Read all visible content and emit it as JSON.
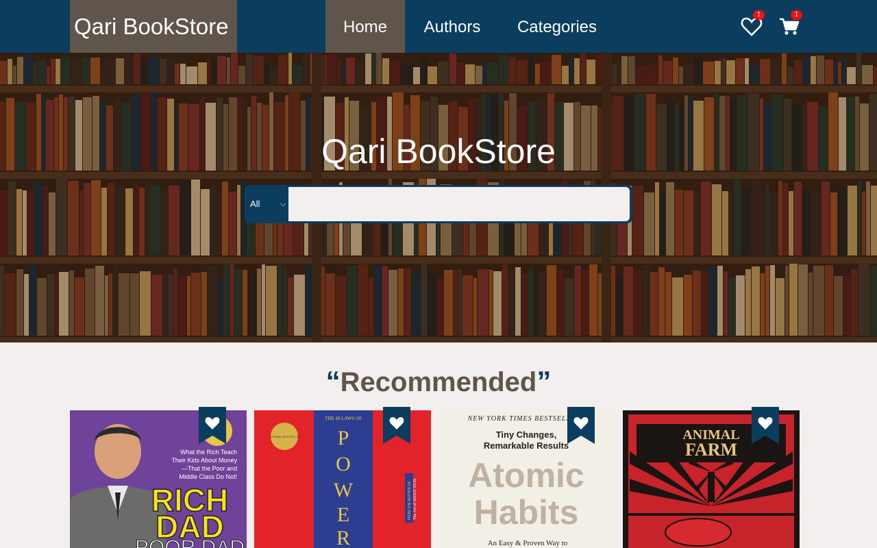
{
  "navbar": {
    "brand": "Qari BookStore",
    "links": [
      {
        "label": "Home",
        "active": true
      },
      {
        "label": "Authors",
        "active": false
      },
      {
        "label": "Categories",
        "active": false
      }
    ],
    "wishlist_count": "1",
    "cart_count": "1",
    "icons": [
      "heart-icon",
      "cart-icon"
    ]
  },
  "hero": {
    "title": "Qari BookStore",
    "search": {
      "category_selected": "All",
      "value": "",
      "placeholder": ""
    }
  },
  "recommended": {
    "open_quote": "“",
    "title": "Recommended",
    "close_quote": "”",
    "books": [
      {
        "cover_texts": [
          "What the Rich Teach",
          "Their Kids About Money",
          "—That the Poor and",
          "Middle Class Do Not!",
          "RICH",
          "DAD",
          "POOR DAD"
        ]
      },
      {
        "cover_texts": [
          "THE 48 LAWS OF",
          "NATIONAL BESTSELLER",
          "P",
          "O",
          "W",
          "E",
          "R",
          "FROM THE AUTHOR OF",
          "The Art of SEDUCTION"
        ]
      },
      {
        "cover_texts": [
          "NEW YORK TIMES BESTSELLER",
          "Tiny Changes,",
          "Remarkable Results",
          "Atomic",
          "Habits",
          "An Easy & Proven Way to"
        ]
      },
      {
        "cover_texts": [
          "ANIMAL",
          "FARM"
        ]
      }
    ]
  },
  "colors": {
    "navy": "#0b3d5e",
    "brown": "#5f554b",
    "page_bg": "#f3efee",
    "badge_red": "#e11111"
  }
}
